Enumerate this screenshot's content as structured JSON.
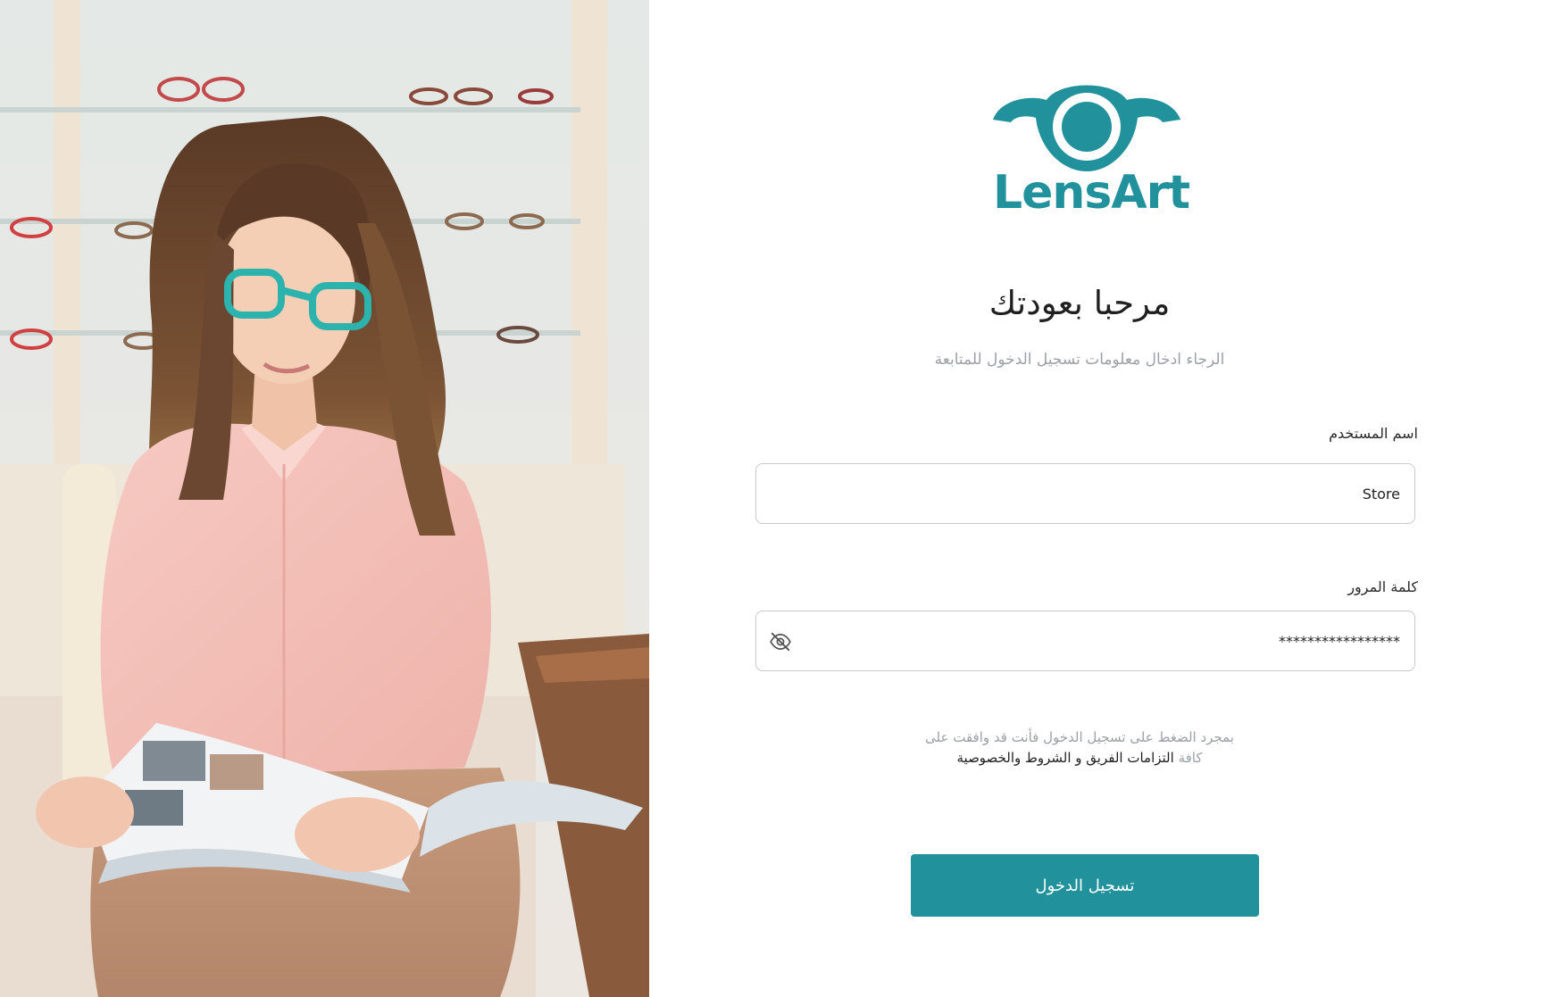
{
  "brand": {
    "name": "LensArt",
    "color": "#21929c"
  },
  "photo": {
    "description_icon": "woman-with-glasses-reading-magazine-photo"
  },
  "login": {
    "title": "مرحبا بعودتك",
    "subtitle": "الرجاء ادخال معلومات تسجيل الدخول للمتابعة",
    "username": {
      "label": "اسم المستخدم",
      "value": "Store"
    },
    "password": {
      "label": "كلمة المرور",
      "value": "*****************",
      "toggle_icon": "eye-off-icon"
    },
    "terms": {
      "line1": "بمجرد الضغط على تسجيل الدخول فأنت قد وافقت على",
      "prefix": "كافة",
      "link": "التزامات الفريق و الشروط والخصوصية"
    },
    "submit_label": "تسجيل الدخول"
  }
}
